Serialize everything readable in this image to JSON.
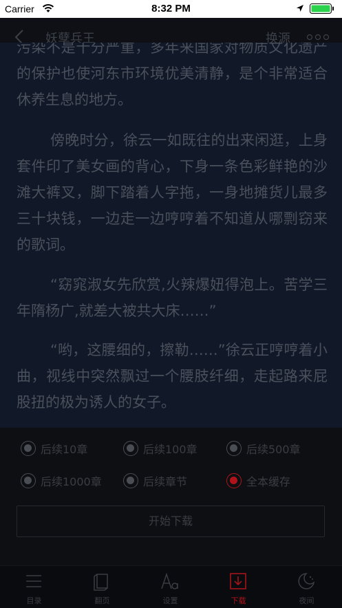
{
  "status_bar": {
    "carrier": "Carrier",
    "time": "8:32 PM"
  },
  "nav": {
    "title": "妖孽兵王",
    "source_label": "换源"
  },
  "reader": {
    "paragraphs": [
      "污染不是十分严重，多年来国家对物质文化遗产的保护也使河东市环境优美清静，是个非常适合休养生息的地方。",
      "傍晚时分，徐云一如既往的出来闲逛，上身套件印了美女画的背心，下身一条色彩鲜艳的沙滩大裤叉，脚下踏着人字拖，一身地摊货儿最多三十块钱，一边走一边哼哼着不知道从哪剽窃来的歌词。",
      "“窈窕淑女先欣赏,火辣爆妞得泡上。苦学三年隋杨广,就差大被共大床……”",
      "“哟，这腰细的，擦勒……”徐云正哼哼着小曲，视线中突然飘过一个腰肢纤细，走起路来屁股扭的极为诱人的女子。"
    ]
  },
  "download": {
    "options": [
      {
        "label": "后续10章",
        "checked": false
      },
      {
        "label": "后续100章",
        "checked": false
      },
      {
        "label": "后续500章",
        "checked": false
      },
      {
        "label": "后续1000章",
        "checked": false
      },
      {
        "label": "后续章节",
        "checked": false
      },
      {
        "label": "全本缓存",
        "checked": true
      }
    ],
    "start_label": "开始下载"
  },
  "tabs": [
    {
      "label": "目录",
      "icon": "list-icon"
    },
    {
      "label": "翻页",
      "icon": "page-flip-icon"
    },
    {
      "label": "设置",
      "icon": "font-settings-icon"
    },
    {
      "label": "下载",
      "icon": "download-icon",
      "active": true
    },
    {
      "label": "夜间",
      "icon": "night-mode-icon"
    }
  ],
  "colors": {
    "accent": "#b0141a",
    "reader_bg": "#111827",
    "panel_bg": "#0d0f13"
  }
}
